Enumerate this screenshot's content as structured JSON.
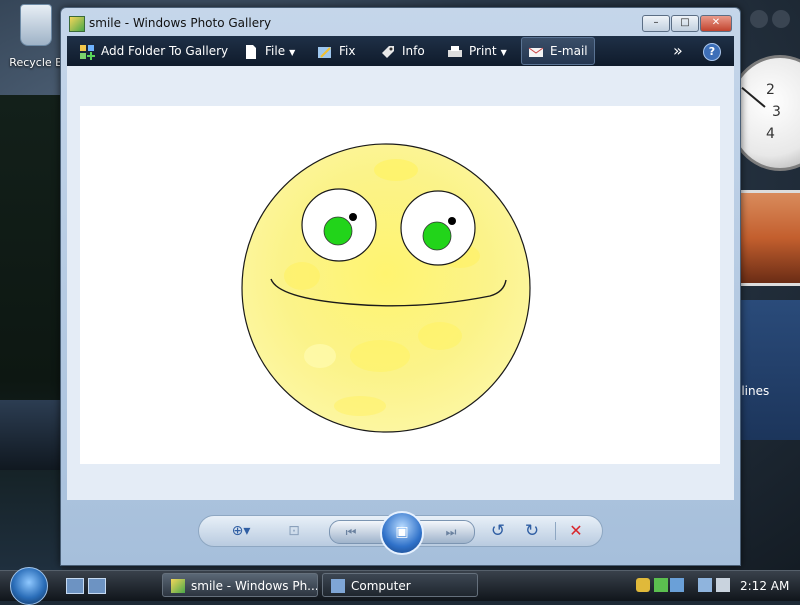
{
  "desktop": {
    "recycle_bin_label": "Recycle B",
    "feed_gadget_text": "llines"
  },
  "window": {
    "title": "smile - Windows Photo Gallery",
    "controls": {
      "minimize": "–",
      "maximize": "□",
      "close": "✕"
    }
  },
  "toolbar": {
    "add_folder": "Add Folder To Gallery",
    "file": "File",
    "fix": "Fix",
    "info": "Info",
    "print": "Print",
    "email": "E-mail",
    "more": "»",
    "help": "?"
  },
  "bottombar": {
    "zoom": "⊕▾",
    "actual_size": "⊡",
    "previous": "⏮",
    "slideshow": "▣",
    "next": "⏭",
    "rotate_left": "↺",
    "rotate_right": "↻",
    "delete": "✕"
  },
  "taskbar": {
    "items": [
      {
        "label": "smile - Windows Ph..."
      },
      {
        "label": "Computer"
      }
    ],
    "time": "2:12 AM"
  },
  "colors": {
    "face": "#fbf58c",
    "face_mottle": "#fff266",
    "iris": "#22d41a",
    "toolbar": "#1a2a3f",
    "delete": "#d9262c"
  }
}
